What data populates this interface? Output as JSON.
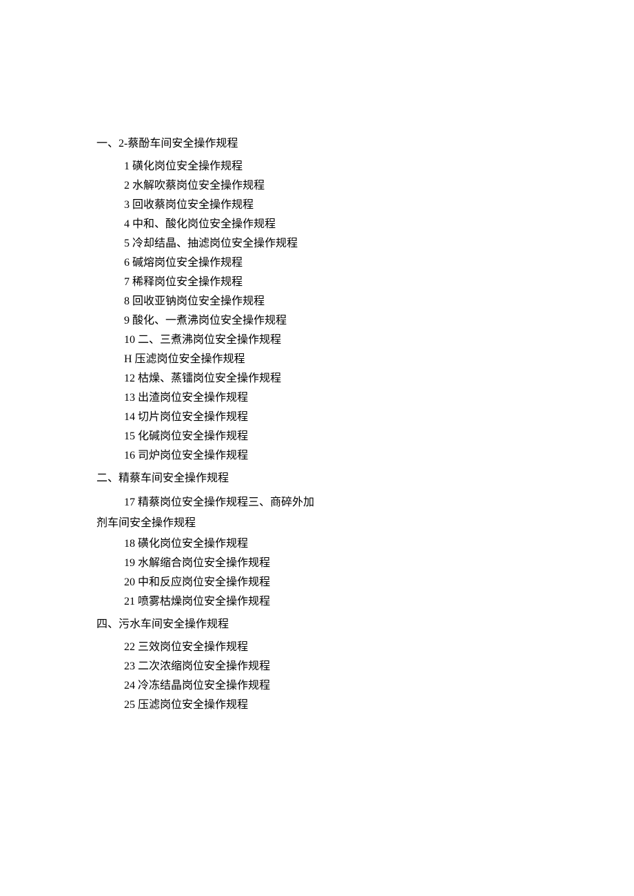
{
  "sections": [
    {
      "heading": "一、2-蔡酚车间安全操作规程",
      "items": [
        "1 磺化岗位安全操作规程",
        "2 水解吹蔡岗位安全操作规程",
        "3 回收蔡岗位安全操作规程",
        "4 中和、酸化岗位安全操作规程",
        "5 冷却结晶、抽滤岗位安全操作规程",
        "6 碱熔岗位安全操作规程",
        "7 稀释岗位安全操作规程",
        "8 回收亚钠岗位安全操作规程",
        "9 酸化、一煮沸岗位安全操作规程",
        "10 二、三煮沸岗位安全操作规程",
        "H 压滤岗位安全操作规程",
        "12 枯燥、蒸镭岗位安全操作规程",
        "13 出渣岗位安全操作规程",
        "14 切片岗位安全操作规程",
        "15 化碱岗位安全操作规程",
        "16 司炉岗位安全操作规程"
      ]
    },
    {
      "heading": "二、精蔡车间安全操作规程",
      "items": [],
      "wrapped_text": "17 精蔡岗位安全操作规程三、商碎外加剂车间安全操作规程",
      "post_items": [
        "18 磺化岗位安全操作规程",
        "19 水解缩合岗位安全操作规程",
        "20 中和反应岗位安全操作规程",
        "21 喷雾枯燥岗位安全操作规程"
      ]
    },
    {
      "heading": "四、污水车间安全操作规程",
      "items": [
        "22 三效岗位安全操作规程",
        "23 二次浓缩岗位安全操作规程",
        "24 冷冻结晶岗位安全操作规程",
        "25 压滤岗位安全操作规程"
      ]
    }
  ]
}
